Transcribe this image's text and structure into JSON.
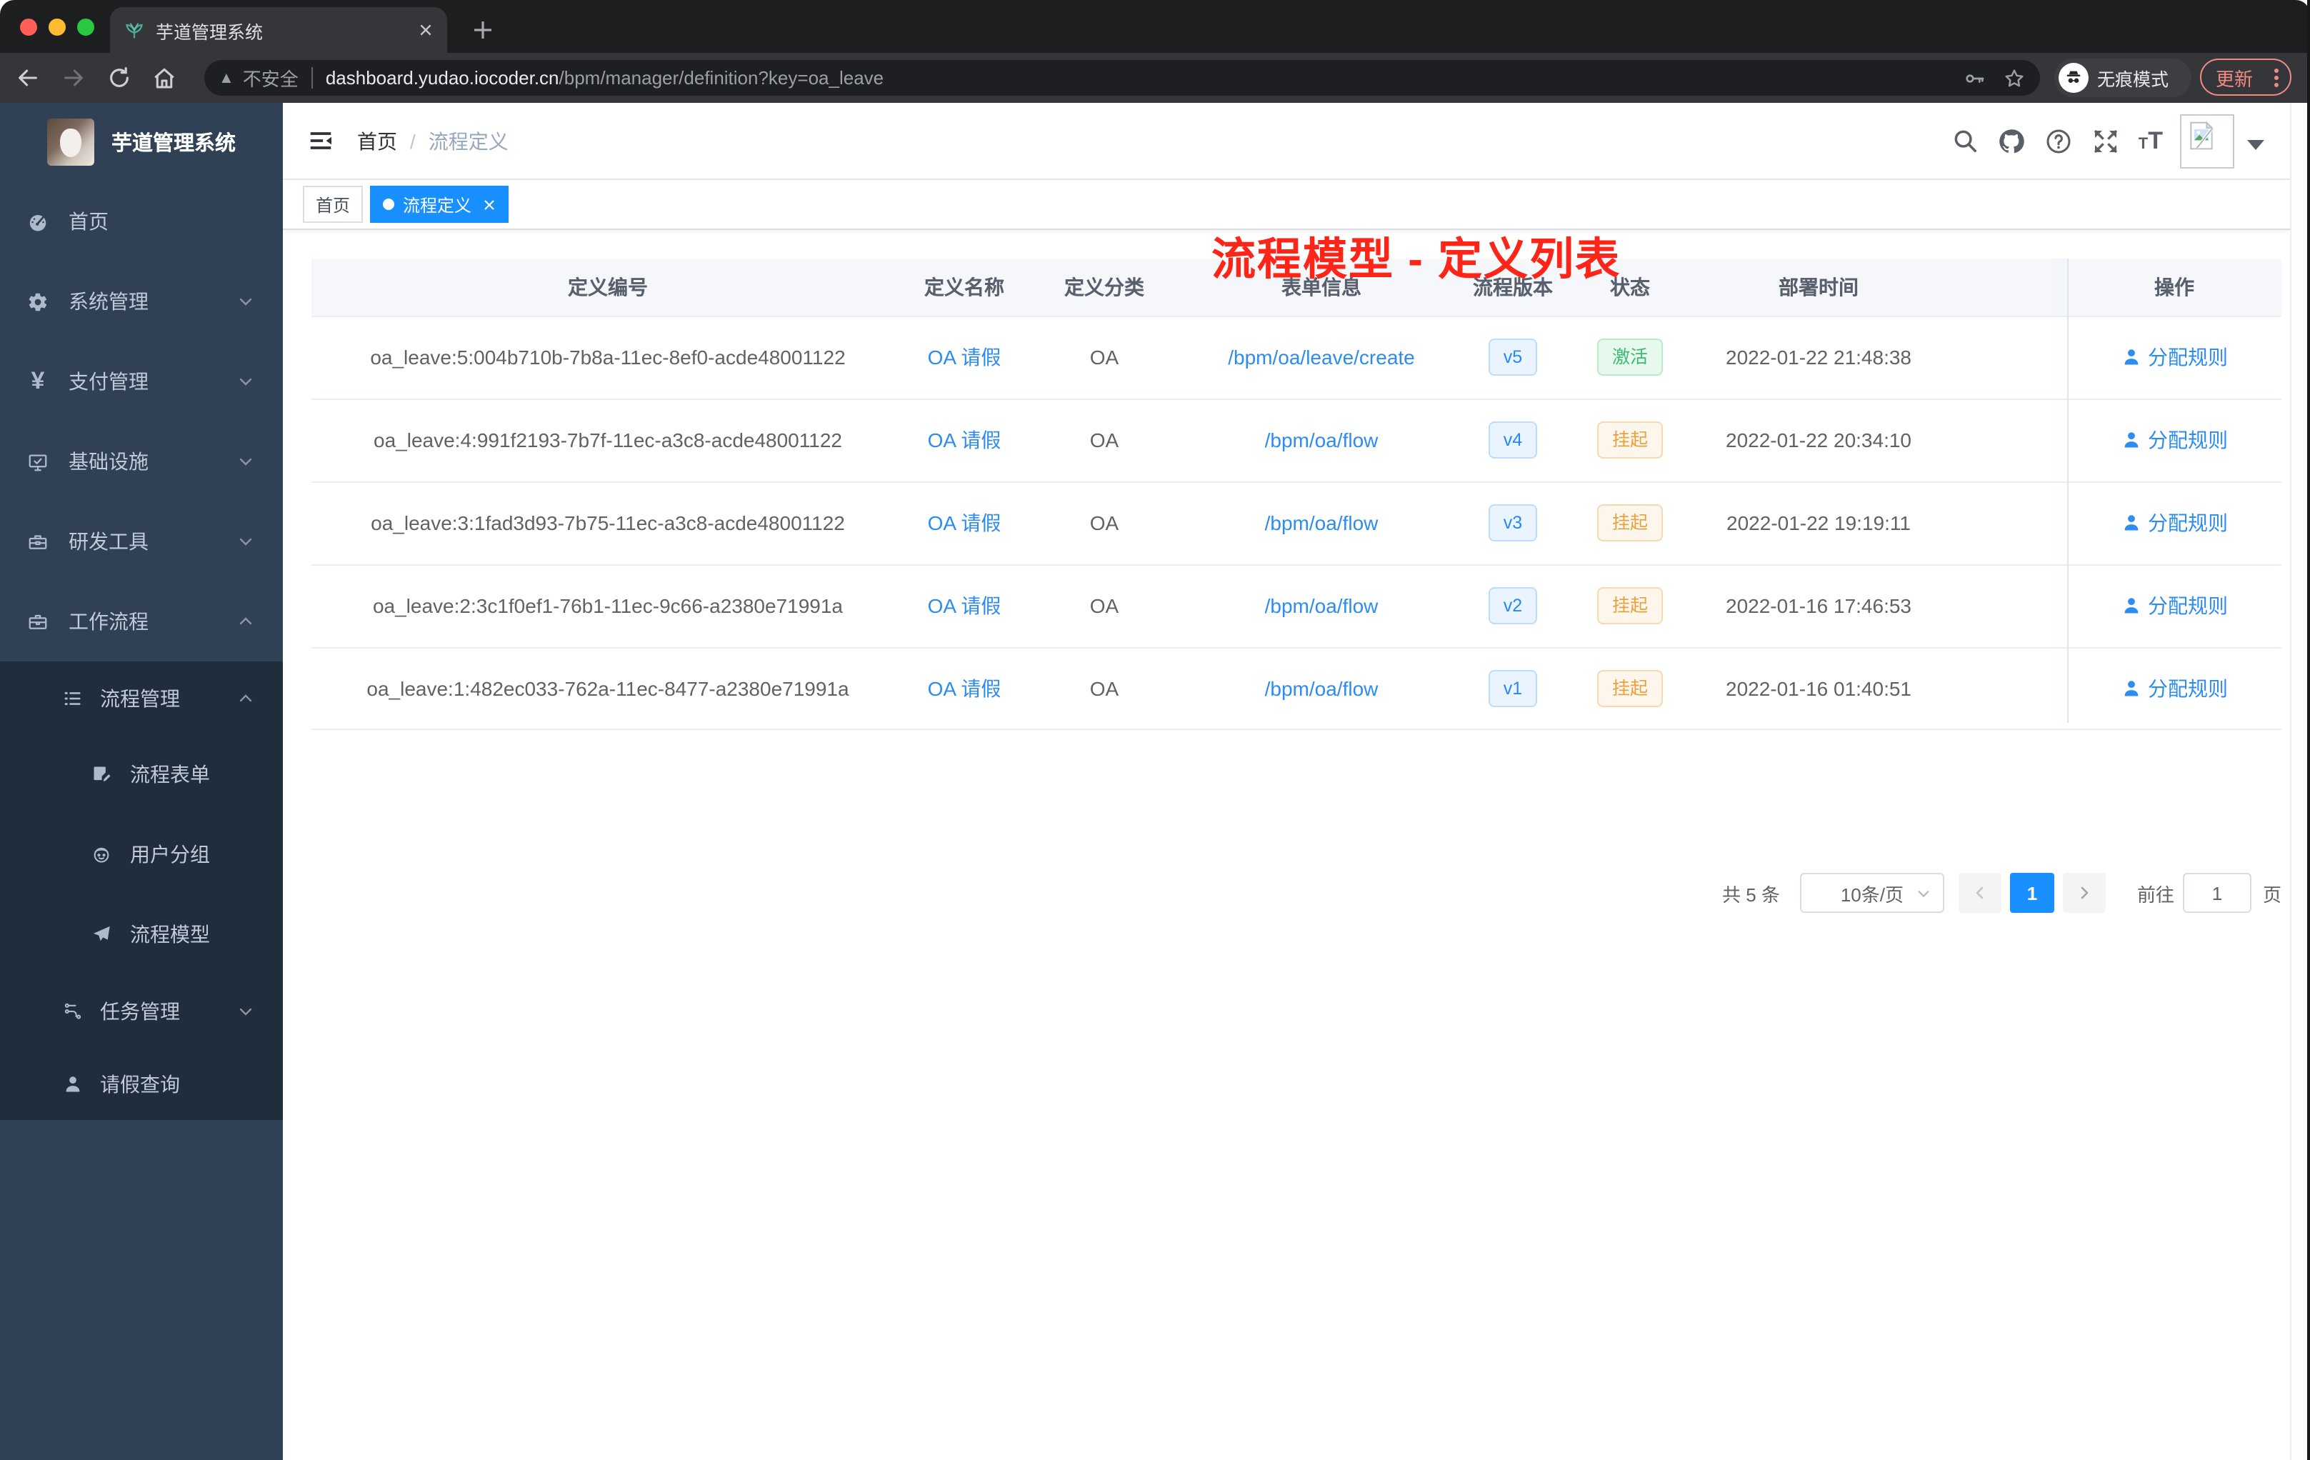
{
  "browser": {
    "tab_title": "芋道管理系统",
    "security_label": "不安全",
    "url_host": "dashboard.yudao.iocoder.cn",
    "url_path": "/bpm/manager/definition?key=oa_leave",
    "incognito_label": "无痕模式",
    "update_label": "更新"
  },
  "sidebar": {
    "title": "芋道管理系统",
    "menu": [
      {
        "label": "首页"
      },
      {
        "label": "系统管理"
      },
      {
        "label": "支付管理"
      },
      {
        "label": "基础设施"
      },
      {
        "label": "研发工具"
      },
      {
        "label": "工作流程"
      }
    ],
    "submenu": [
      {
        "label": "流程管理"
      },
      {
        "label": "流程表单"
      },
      {
        "label": "用户分组"
      },
      {
        "label": "流程模型"
      },
      {
        "label": "任务管理"
      },
      {
        "label": "请假查询"
      }
    ]
  },
  "header": {
    "breadcrumb_home": "首页",
    "breadcrumb_sep": "/",
    "breadcrumb_current": "流程定义"
  },
  "annotation": {
    "text": "流程模型 - 定义列表",
    "color": "#fd2418"
  },
  "tags": [
    {
      "label": "首页",
      "active": false
    },
    {
      "label": "流程定义",
      "active": true
    }
  ],
  "table": {
    "columns": [
      "定义编号",
      "定义名称",
      "定义分类",
      "表单信息",
      "流程版本",
      "状态",
      "部署时间",
      "操作"
    ],
    "rows": [
      {
        "id": "oa_leave:5:004b710b-7b8a-11ec-8ef0-acde48001122",
        "name": "OA 请假",
        "category": "OA",
        "form": "/bpm/oa/leave/create",
        "version": "v5",
        "status": "激活",
        "status_type": "success",
        "time": "2022-01-22 21:48:38",
        "action": "分配规则"
      },
      {
        "id": "oa_leave:4:991f2193-7b7f-11ec-a3c8-acde48001122",
        "name": "OA 请假",
        "category": "OA",
        "form": "/bpm/oa/flow",
        "version": "v4",
        "status": "挂起",
        "status_type": "warning",
        "time": "2022-01-22 20:34:10",
        "action": "分配规则"
      },
      {
        "id": "oa_leave:3:1fad3d93-7b75-11ec-a3c8-acde48001122",
        "name": "OA 请假",
        "category": "OA",
        "form": "/bpm/oa/flow",
        "version": "v3",
        "status": "挂起",
        "status_type": "warning",
        "time": "2022-01-22 19:19:11",
        "action": "分配规则"
      },
      {
        "id": "oa_leave:2:3c1f0ef1-76b1-11ec-9c66-a2380e71991a",
        "name": "OA 请假",
        "category": "OA",
        "form": "/bpm/oa/flow",
        "version": "v2",
        "status": "挂起",
        "status_type": "warning",
        "time": "2022-01-16 17:46:53",
        "action": "分配规则"
      },
      {
        "id": "oa_leave:1:482ec033-762a-11ec-8477-a2380e71991a",
        "name": "OA 请假",
        "category": "OA",
        "form": "/bpm/oa/flow",
        "version": "v1",
        "status": "挂起",
        "status_type": "warning",
        "time": "2022-01-16 01:40:51",
        "action": "分配规则"
      }
    ]
  },
  "pagination": {
    "total": "共 5 条",
    "page_size": "10条/页",
    "current": "1",
    "goto": "前往",
    "goto_value": "1",
    "unit": "页"
  },
  "colors": {
    "accent": "#1890ff",
    "link": "#2d8cf0",
    "version_tag": "#2688f8",
    "status_active": "#3db873",
    "status_suspended": "#e6a23c",
    "annotation_red": "#fd2418",
    "sidebar_bg": "#304156",
    "submenu_bg": "#1f2d3d"
  }
}
